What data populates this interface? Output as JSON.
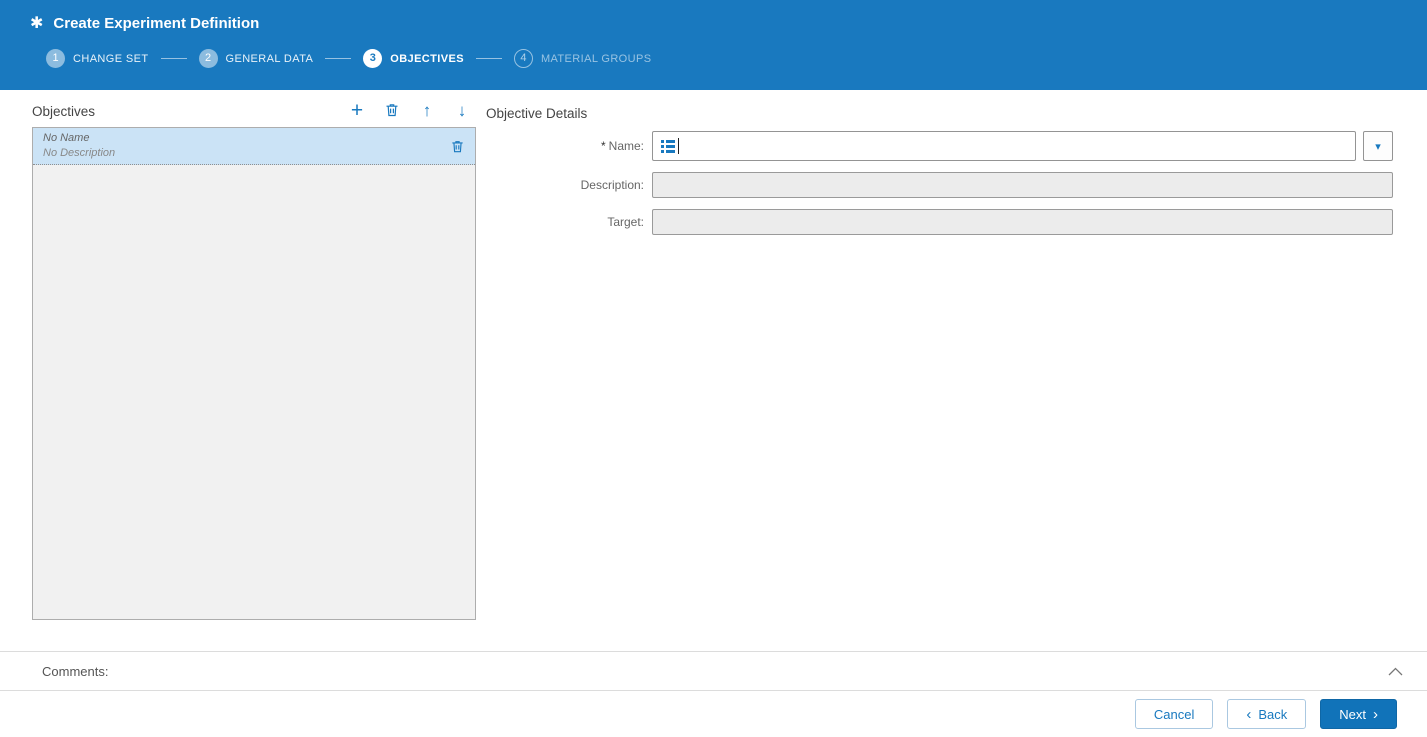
{
  "header": {
    "title": "Create Experiment Definition",
    "title_icon": "✱",
    "steps": [
      {
        "number": "1",
        "label": "CHANGE SET",
        "state": "done"
      },
      {
        "number": "2",
        "label": "GENERAL DATA",
        "state": "done"
      },
      {
        "number": "3",
        "label": "OBJECTIVES",
        "state": "active"
      },
      {
        "number": "4",
        "label": "MATERIAL GROUPS",
        "state": "todo"
      }
    ]
  },
  "objectives_panel": {
    "title": "Objectives",
    "toolbar": {
      "add_icon": "+",
      "move_up_icon": "↑",
      "move_down_icon": "↓"
    },
    "items": [
      {
        "name": "No Name",
        "description": "No Description"
      }
    ]
  },
  "details_panel": {
    "title": "Objective Details",
    "required_marker": "*",
    "name_label": "Name:",
    "name_value": "",
    "description_label": "Description:",
    "description_value": "",
    "target_label": "Target:",
    "target_value": "",
    "dropdown_icon": "▾"
  },
  "comments": {
    "label": "Comments:"
  },
  "footer": {
    "cancel_label": "Cancel",
    "back_chevron": "‹",
    "back_label": "Back",
    "next_label": "Next",
    "next_chevron": "›"
  },
  "colors": {
    "header_blue": "#1979bf",
    "accent_blue": "#1173b9",
    "selected_item_bg": "#cbe3f6"
  }
}
